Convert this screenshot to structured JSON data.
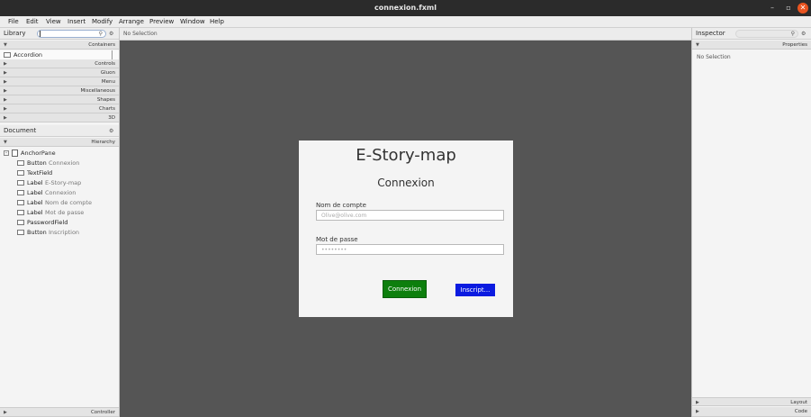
{
  "window": {
    "title": "connexion.fxml",
    "minimize": "–",
    "maximize": "▫",
    "close": "✕"
  },
  "menu": [
    "File",
    "Edit",
    "View",
    "Insert",
    "Modify",
    "Arrange",
    "Preview",
    "Window",
    "Help"
  ],
  "library": {
    "title": "Library",
    "search_value": "",
    "sections": [
      "Containers",
      "Controls",
      "Gluon",
      "Menu",
      "Miscellaneous",
      "Shapes",
      "Charts",
      "3D"
    ],
    "container_item": "Accordion"
  },
  "document": {
    "title": "Document",
    "section": "Hierarchy",
    "root": "AnchorPane",
    "children": [
      {
        "type": "Button",
        "name": "Connexion"
      },
      {
        "type": "TextField",
        "name": ""
      },
      {
        "type": "Label",
        "name": "E-Story-map"
      },
      {
        "type": "Label",
        "name": "Connexion"
      },
      {
        "type": "Label",
        "name": "Nom de compte"
      },
      {
        "type": "Label",
        "name": "Mot de passe"
      },
      {
        "type": "PasswordField",
        "name": ""
      },
      {
        "type": "Button",
        "name": "Inscription"
      }
    ],
    "footer": "Controller"
  },
  "canvas": {
    "crumb": "No Selection",
    "form": {
      "title": "E-Story-map",
      "subtitle": "Connexion",
      "account_label": "Nom de compte",
      "account_placeholder": "Olive@olive.com",
      "password_label": "Mot de passe",
      "password_placeholder": "••••••••",
      "login_button": "Connexion",
      "signup_button": "Inscript..."
    }
  },
  "inspector": {
    "title": "Inspector",
    "section": "Properties",
    "empty": "No Selection",
    "footer_sections": [
      "Layout",
      "Code"
    ]
  }
}
